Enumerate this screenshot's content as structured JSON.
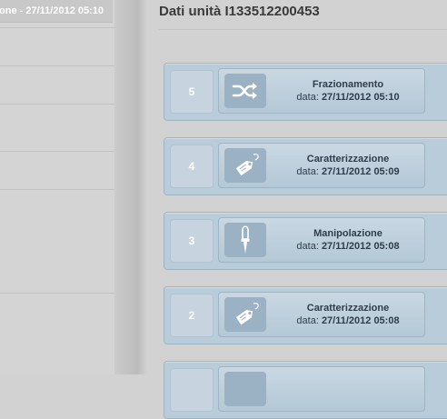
{
  "sidebar": {
    "selected_label": "one - 27/11/2012 05:10"
  },
  "main": {
    "title": "Dati unità I133512200453",
    "events": [
      {
        "number": "5",
        "name": "Frazionamento",
        "date_label": "data:",
        "date": "27/11/2012 05:10",
        "icon": "shuffle-icon"
      },
      {
        "number": "4",
        "name": "Caratterizzazione",
        "date_label": "data:",
        "date": "27/11/2012 05:09",
        "icon": "tag-icon"
      },
      {
        "number": "3",
        "name": "Manipolazione",
        "date_label": "data:",
        "date": "27/11/2012 05:08",
        "icon": "pipette-icon"
      },
      {
        "number": "2",
        "name": "Caratterizzazione",
        "date_label": "data:",
        "date": "27/11/2012 05:08",
        "icon": "tag-icon"
      }
    ]
  },
  "colors": {
    "card_background": "#b9ccd9",
    "icon_tile": "#9bb2c4",
    "page_background": "#d2d2d2"
  }
}
